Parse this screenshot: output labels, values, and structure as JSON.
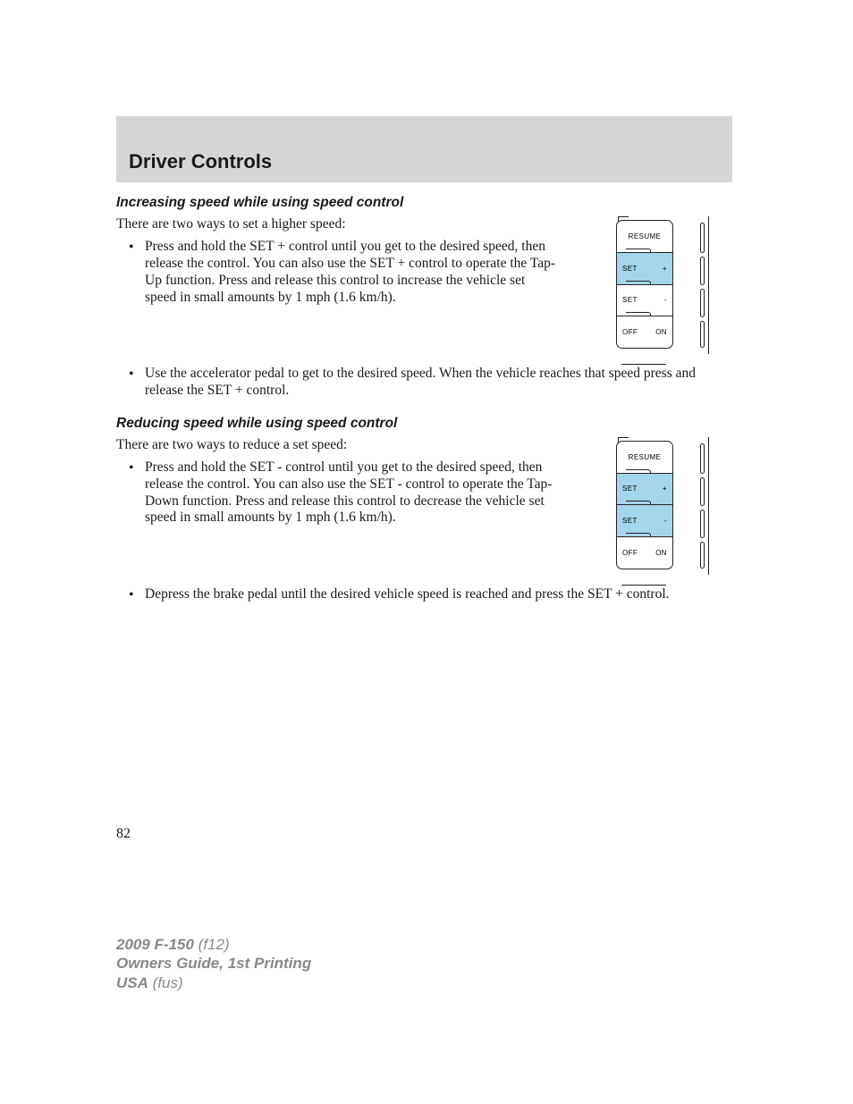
{
  "header": {
    "title": "Driver Controls"
  },
  "sections": [
    {
      "subheading": "Increasing speed while using speed control",
      "intro": "There are two ways to set a higher speed:",
      "bullets": [
        "Press and hold the SET + control until you get to the desired speed, then release the control. You can also use the SET + control to operate the Tap-Up function. Press and release this control to increase the vehicle set speed in small amounts by 1 mph (1.6 km/h).",
        "Use the accelerator pedal to get to the desired speed. When the vehicle reaches that speed press and release the SET + control."
      ],
      "diagram_highlight": 1
    },
    {
      "subheading": "Reducing speed while using speed control",
      "intro": "There are two ways to reduce a set speed:",
      "bullets": [
        "Press and hold the SET - control until you get to the desired speed, then release the control. You can also use the SET - control to operate the Tap-Down function. Press and release this control to decrease the vehicle set speed in small amounts by 1 mph (1.6 km/h).",
        "Depress the brake pedal until the desired vehicle speed is reached and press the SET + control."
      ],
      "diagram_highlight": 2
    }
  ],
  "diagram_buttons": {
    "b1": "RESUME",
    "b2_left": "SET",
    "b2_right": "+",
    "b3_left": "SET",
    "b3_right": "-",
    "b4_left": "OFF",
    "b4_right": "ON"
  },
  "page_number": "82",
  "footer": {
    "model_bold": "2009 F-150",
    "model_suffix": " (f12)",
    "guide_bold": "Owners Guide, 1st Printing",
    "region_bold": "USA",
    "region_suffix": " (fus)"
  }
}
